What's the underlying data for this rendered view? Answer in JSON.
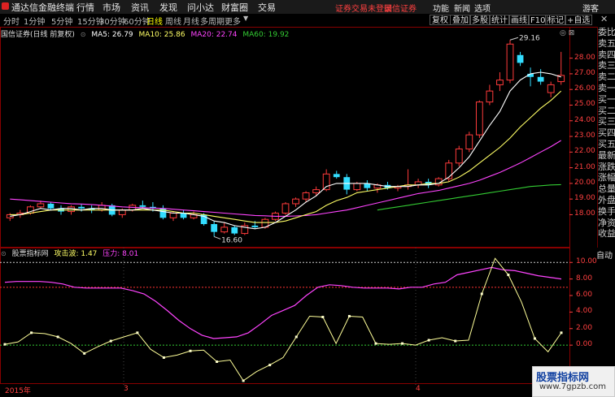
{
  "menubar": {
    "app_title": "通达信金融终端",
    "items": [
      "行情",
      "市场",
      "资讯",
      "发现",
      "问小达",
      "财富圈",
      "交易"
    ],
    "alerts": [
      "证券交易未登录",
      "国信证券"
    ],
    "right_items": [
      "功能",
      "新闻",
      "选项",
      "游客"
    ]
  },
  "toolbar": {
    "periods": [
      "分时",
      "1分钟",
      "5分钟",
      "15分钟",
      "30分钟",
      "60分钟",
      "日线",
      "周线",
      "月线",
      "多周期",
      "更多"
    ],
    "active_period": "日线",
    "buttons": [
      "复权",
      "叠加",
      "多股",
      "统计",
      "画线",
      "F10",
      "标记",
      "+自选"
    ],
    "close_icon": "close-icon"
  },
  "main_chart": {
    "title": "国信证券(日线 前复权)",
    "ma_legend": [
      {
        "label": "MA5: 26.79",
        "color": "#ffffff"
      },
      {
        "label": "MA10: 25.86",
        "color": "#ffff66"
      },
      {
        "label": "MA20: 22.74",
        "color": "#ff44ff"
      },
      {
        "label": "MA60: 19.92",
        "color": "#33cc33"
      }
    ],
    "y_ticks": [
      "28.00",
      "27.00",
      "26.00",
      "25.00",
      "24.00",
      "23.00",
      "22.00",
      "21.00",
      "20.00",
      "19.00",
      "18.00"
    ],
    "high_label": "29.16",
    "low_label": "16.60"
  },
  "indicator": {
    "name": "股票指标网",
    "attack_label": "攻击波: 1.47",
    "pressure_label": "压力: 8.01",
    "y_ticks": [
      "10.00",
      "8.00",
      "6.00",
      "4.00",
      "2.00",
      "0.00"
    ],
    "auto_label": "自动"
  },
  "side_panel": {
    "tabs": [
      "委比",
      "卖五",
      "卖四",
      "卖三",
      "卖二",
      "卖一",
      "买一",
      "买二",
      "买三",
      "买四",
      "买五",
      "最新",
      "涨跌",
      "涨幅",
      "总量",
      "外盘",
      "换手",
      "净资",
      "收益"
    ]
  },
  "date_axis": [
    "2015年",
    "3",
    "4"
  ],
  "watermark": {
    "title": "股票指标网",
    "url": "www.7gpzb.com"
  },
  "colors": {
    "up": "#ff3b3b",
    "down": "#33ddff",
    "grid": "#880000"
  },
  "candles": [
    [
      17.8,
      18.1,
      17.6,
      18.0
    ],
    [
      18.0,
      18.3,
      17.8,
      18.1
    ],
    [
      18.1,
      18.6,
      18.0,
      18.5
    ],
    [
      18.5,
      18.9,
      18.4,
      18.7
    ],
    [
      18.7,
      18.8,
      18.3,
      18.4
    ],
    [
      18.4,
      18.6,
      18.0,
      18.2
    ],
    [
      18.2,
      18.6,
      18.0,
      18.5
    ],
    [
      18.5,
      18.7,
      18.2,
      18.4
    ],
    [
      18.4,
      18.6,
      18.1,
      18.3
    ],
    [
      18.3,
      18.8,
      18.2,
      18.6
    ],
    [
      18.6,
      18.7,
      17.9,
      18.0
    ],
    [
      18.0,
      18.4,
      17.8,
      18.3
    ],
    [
      18.3,
      18.7,
      18.2,
      18.6
    ],
    [
      18.6,
      18.9,
      18.4,
      18.5
    ],
    [
      18.5,
      18.8,
      18.2,
      18.4
    ],
    [
      18.4,
      18.6,
      17.7,
      17.8
    ],
    [
      17.8,
      18.2,
      17.6,
      18.1
    ],
    [
      18.1,
      18.3,
      17.7,
      17.8
    ],
    [
      17.8,
      18.2,
      17.7,
      18.0
    ],
    [
      18.0,
      18.1,
      17.3,
      17.4
    ],
    [
      17.4,
      17.6,
      16.6,
      16.9
    ],
    [
      16.9,
      17.5,
      16.8,
      17.2
    ],
    [
      17.2,
      17.3,
      16.7,
      16.8
    ],
    [
      16.8,
      17.5,
      16.7,
      17.3
    ],
    [
      17.3,
      17.6,
      17.1,
      17.2
    ],
    [
      17.2,
      17.8,
      17.1,
      17.7
    ],
    [
      17.7,
      18.2,
      17.6,
      18.1
    ],
    [
      18.1,
      18.8,
      18.0,
      18.7
    ],
    [
      18.7,
      19.1,
      18.5,
      19.0
    ],
    [
      19.0,
      19.5,
      18.8,
      19.4
    ],
    [
      19.4,
      19.8,
      19.2,
      19.6
    ],
    [
      19.6,
      20.9,
      19.5,
      20.6
    ],
    [
      20.6,
      20.8,
      20.3,
      20.4
    ],
    [
      20.4,
      20.6,
      19.3,
      19.6
    ],
    [
      19.6,
      20.1,
      19.5,
      20.0
    ],
    [
      20.0,
      20.2,
      19.5,
      19.7
    ],
    [
      19.7,
      20.0,
      19.4,
      19.9
    ],
    [
      19.9,
      20.1,
      19.6,
      19.7
    ],
    [
      19.7,
      19.9,
      19.5,
      19.8
    ],
    [
      19.8,
      20.9,
      19.6,
      19.9
    ],
    [
      19.9,
      20.3,
      19.7,
      20.1
    ],
    [
      20.1,
      20.3,
      19.7,
      19.9
    ],
    [
      19.9,
      20.4,
      19.8,
      20.3
    ],
    [
      20.3,
      21.5,
      20.1,
      21.3
    ],
    [
      21.3,
      22.4,
      21.1,
      22.2
    ],
    [
      22.2,
      23.3,
      22.0,
      23.1
    ],
    [
      23.1,
      25.3,
      22.9,
      25.2
    ],
    [
      25.2,
      26.3,
      25.0,
      25.9
    ],
    [
      26.3,
      27.1,
      25.9,
      26.6
    ],
    [
      26.6,
      29.16,
      26.4,
      28.9
    ],
    [
      28.2,
      28.4,
      27.5,
      27.7
    ],
    [
      27.0,
      27.4,
      26.2,
      26.8
    ],
    [
      26.8,
      27.3,
      26.3,
      26.5
    ],
    [
      25.8,
      26.5,
      25.5,
      26.3
    ],
    [
      26.5,
      28.4,
      26.3,
      26.9
    ]
  ],
  "ma_series": {
    "ma5": [
      17.9,
      18.0,
      18.2,
      18.4,
      18.3,
      18.4,
      18.4,
      18.3,
      18.4,
      18.4,
      18.3,
      18.3,
      18.3,
      18.4,
      18.3,
      18.2,
      18.1,
      18.1,
      18.0,
      17.9,
      17.6,
      17.5,
      17.3,
      17.2,
      17.1,
      17.2,
      17.5,
      17.9,
      18.3,
      18.8,
      19.2,
      19.8,
      20.0,
      20.0,
      20.0,
      20.0,
      19.9,
      19.8,
      19.8,
      19.8,
      19.9,
      19.9,
      20.0,
      20.4,
      21.0,
      21.7,
      22.7,
      23.7,
      24.6,
      25.9,
      26.6,
      27.0,
      27.1,
      27.0,
      26.8
    ],
    "ma10": [
      18.0,
      18.0,
      18.1,
      18.2,
      18.3,
      18.3,
      18.3,
      18.3,
      18.3,
      18.3,
      18.3,
      18.3,
      18.3,
      18.3,
      18.3,
      18.3,
      18.2,
      18.1,
      18.1,
      18.0,
      17.9,
      17.8,
      17.7,
      17.6,
      17.5,
      17.5,
      17.5,
      17.6,
      17.8,
      18.0,
      18.2,
      18.6,
      18.9,
      19.1,
      19.4,
      19.5,
      19.6,
      19.7,
      19.8,
      19.9,
      19.9,
      20.0,
      20.0,
      20.1,
      20.4,
      20.8,
      21.3,
      21.8,
      22.3,
      22.9,
      23.6,
      24.2,
      24.8,
      25.3,
      25.9
    ],
    "ma20": [
      19.0,
      18.95,
      18.9,
      18.85,
      18.8,
      18.75,
      18.7,
      18.68,
      18.65,
      18.6,
      18.55,
      18.5,
      18.47,
      18.45,
      18.42,
      18.4,
      18.35,
      18.3,
      18.25,
      18.2,
      18.15,
      18.1,
      18.05,
      18.0,
      17.95,
      17.93,
      17.9,
      17.9,
      17.92,
      17.95,
      18.0,
      18.1,
      18.2,
      18.3,
      18.45,
      18.6,
      18.75,
      18.9,
      19.05,
      19.2,
      19.35,
      19.45,
      19.55,
      19.7,
      19.85,
      20.0,
      20.2,
      20.45,
      20.7,
      21.0,
      21.3,
      21.65,
      22.0,
      22.35,
      22.74
    ],
    "ma60_start": 36,
    "ma60": [
      18.3,
      18.4,
      18.5,
      18.6,
      18.7,
      18.8,
      18.9,
      19.0,
      19.1,
      19.2,
      19.3,
      19.4,
      19.5,
      19.6,
      19.7,
      19.8,
      19.85,
      19.9,
      19.92
    ]
  },
  "indicator_series": {
    "attack": [
      0.1,
      0.4,
      1.5,
      1.4,
      1.0,
      0.2,
      -1.0,
      -0.2,
      0.5,
      1.0,
      1.5,
      -0.5,
      -1.5,
      -1.2,
      -0.7,
      -0.6,
      -2.0,
      -1.8,
      -4.3,
      -3.2,
      -2.4,
      -1.5,
      1.0,
      3.5,
      3.4,
      0.2,
      3.5,
      3.4,
      0.2,
      0.1,
      0.2,
      0.0,
      0.6,
      0.9,
      0.5,
      0.6,
      6.2,
      10.5,
      8.5,
      5.2,
      0.8,
      -0.8,
      1.5
    ],
    "pressure": [
      7.6,
      7.7,
      7.7,
      7.7,
      7.6,
      7.4,
      7.0,
      6.9,
      6.9,
      6.9,
      6.9,
      6.6,
      6.2,
      5.3,
      4.2,
      3.0,
      2.0,
      1.2,
      0.8,
      0.9,
      1.0,
      1.5,
      2.5,
      3.6,
      4.2,
      4.8,
      6.0,
      7.0,
      7.3,
      7.2,
      7.0,
      6.9,
      6.9,
      6.9,
      6.8,
      7.0,
      7.0,
      7.4,
      7.6,
      8.5,
      8.8,
      9.1,
      9.4,
      9.1,
      9.0,
      8.7,
      8.4,
      8.2,
      8.0
    ]
  }
}
